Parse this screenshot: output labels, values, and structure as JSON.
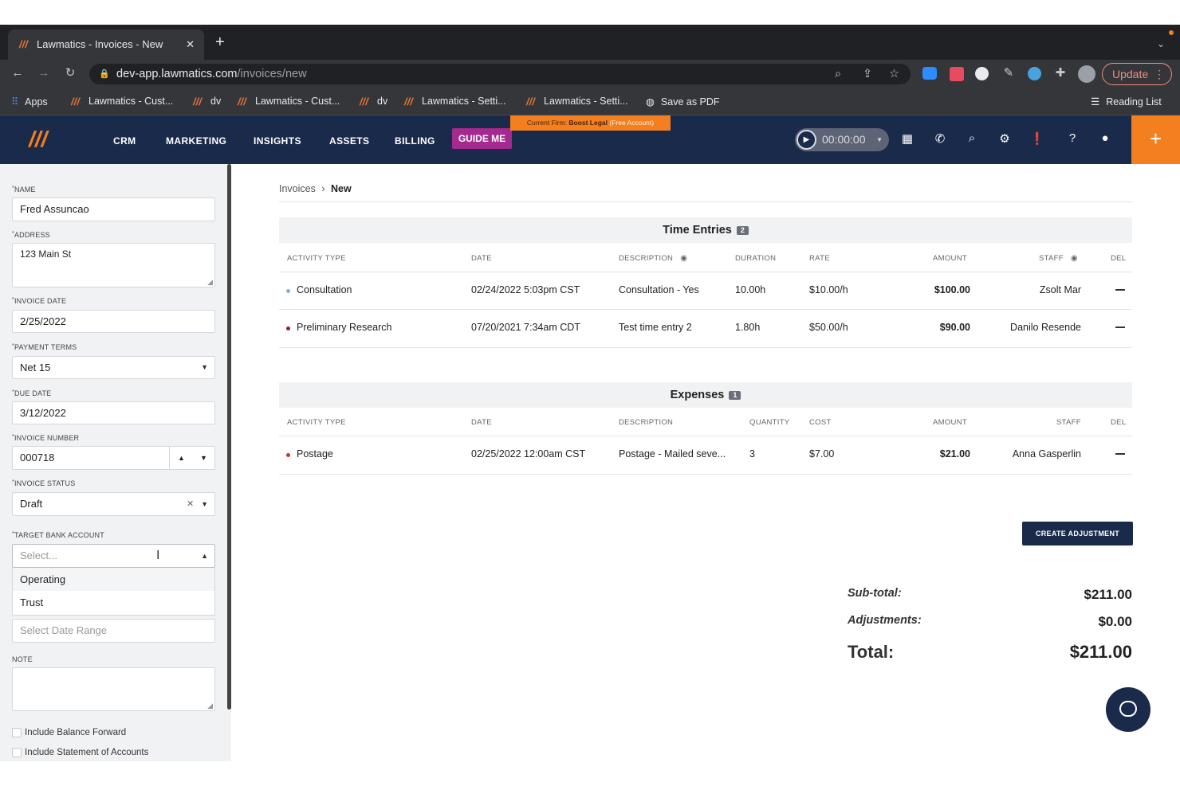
{
  "browser": {
    "tab_title": "Lawmatics - Invoices - New",
    "tab_close": "✕",
    "new_tab": "+",
    "url_host": "dev-app.lawmatics.com",
    "url_path": "/invoices/new",
    "update_label": "Update",
    "bookmarks": [
      {
        "label": "Apps",
        "icon": "apps-grid-icon"
      },
      {
        "label": "Lawmatics - Cust...",
        "icon": "lawmatics-icon"
      },
      {
        "label": "dv",
        "icon": "lawmatics-icon"
      },
      {
        "label": "Lawmatics - Cust...",
        "icon": "lawmatics-icon"
      },
      {
        "label": "dv",
        "icon": "lawmatics-icon"
      },
      {
        "label": "Lawmatics - Setti...",
        "icon": "lawmatics-icon"
      },
      {
        "label": "Lawmatics - Setti...",
        "icon": "lawmatics-icon"
      },
      {
        "label": "Save as PDF",
        "icon": "globe-icon"
      }
    ],
    "reading_list": "Reading List"
  },
  "appbar": {
    "nav": [
      "CRM",
      "MARKETING",
      "INSIGHTS",
      "ASSETS",
      "BILLING"
    ],
    "guide_me": "GUIDE ME",
    "firm_prefix": "Current Firm:",
    "firm_name": "Boost Legal",
    "firm_note": "(Free Account)",
    "timer": "00:00:00",
    "brand_color": "#1a2a4a",
    "accent_color": "#f47f1f"
  },
  "form": {
    "name_label": "NAME",
    "name_value": "Fred Assuncao",
    "address_label": "ADDRESS",
    "address_value": "123 Main St",
    "invoice_date_label": "INVOICE DATE",
    "invoice_date_value": "2/25/2022",
    "payment_terms_label": "PAYMENT TERMS",
    "payment_terms_value": "Net 15",
    "due_date_label": "DUE DATE",
    "due_date_value": "3/12/2022",
    "invoice_number_label": "INVOICE NUMBER",
    "invoice_number_value": "000718",
    "invoice_status_label": "INVOICE STATUS",
    "invoice_status_value": "Draft",
    "target_bank_label": "TARGET BANK ACCOUNT",
    "target_bank_placeholder": "Select...",
    "target_bank_options": [
      "Operating",
      "Trust"
    ],
    "date_range_placeholder": "Select Date Range",
    "note_label": "NOTE",
    "include_balance": "Include Balance Forward",
    "include_statement": "Include Statement of Accounts"
  },
  "breadcrumb": {
    "root": "Invoices",
    "current": "New"
  },
  "time_entries": {
    "title": "Time Entries",
    "count": "2",
    "columns": [
      "ACTIVITY TYPE",
      "DATE",
      "DESCRIPTION",
      "DURATION",
      "RATE",
      "AMOUNT",
      "STAFF",
      "DEL"
    ],
    "rows": [
      {
        "activity": "Consultation",
        "date": "02/24/2022 5:03pm CST",
        "description": "Consultation - Yes",
        "duration": "10.00h",
        "rate": "$10.00/h",
        "amount": "$100.00",
        "staff": "Zsolt Mar",
        "dot_color": "#7fb3d5"
      },
      {
        "activity": "Preliminary Research",
        "date": "07/20/2021 7:34am CDT",
        "description": "Test time entry 2",
        "duration": "1.80h",
        "rate": "$50.00/h",
        "amount": "$90.00",
        "staff": "Danilo Resende",
        "dot_color": "#8a1c4a"
      }
    ]
  },
  "expenses": {
    "title": "Expenses",
    "count": "1",
    "columns": [
      "ACTIVITY TYPE",
      "DATE",
      "DESCRIPTION",
      "QUANTITY",
      "COST",
      "AMOUNT",
      "STAFF",
      "DEL"
    ],
    "rows": [
      {
        "activity": "Postage",
        "date": "02/25/2022 12:00am CST",
        "description": "Postage - Mailed seve...",
        "quantity": "3",
        "cost": "$7.00",
        "amount": "$21.00",
        "staff": "Anna Gasperlin",
        "dot_color": "#c0392b"
      }
    ]
  },
  "actions": {
    "create_adjustment": "CREATE ADJUSTMENT"
  },
  "totals": {
    "subtotal_label": "Sub-total:",
    "subtotal_value": "$211.00",
    "adjustments_label": "Adjustments:",
    "adjustments_value": "$0.00",
    "total_label": "Total:",
    "total_value": "$211.00"
  }
}
